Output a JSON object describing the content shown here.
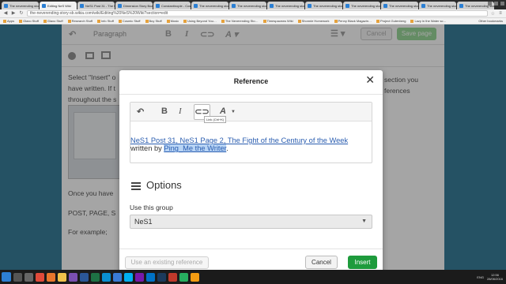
{
  "browser": {
    "tabs": [
      {
        "label": "The neverending story sto…",
        "active": false
      },
      {
        "label": "Editing NeS Wiki",
        "active": true
      },
      {
        "label": "NeS1 Post 31 - The Neve…",
        "active": false
      },
      {
        "label": "Dimension Story Board",
        "active": false
      },
      {
        "label": "Constantinople - Cosmo…",
        "active": false
      },
      {
        "label": "The neverending story sto…",
        "active": false
      },
      {
        "label": "The neverending story sto…",
        "active": false
      },
      {
        "label": "The neverending story sto…",
        "active": false
      },
      {
        "label": "The neverending story sto…",
        "active": false
      },
      {
        "label": "The neverending story sto…",
        "active": false
      },
      {
        "label": "The neverending story sto…",
        "active": false
      },
      {
        "label": "The neverending story sto…",
        "active": false
      },
      {
        "label": "The neverending story sto…",
        "active": false
      }
    ],
    "user": "Asha Lawrence",
    "url": "the-neverending-story-sb.wikia.com/wiki/Editing%20NeS%20Wiki?section=edit",
    "bookmarks": [
      "Apps",
      "Glaxo Stuff",
      "Glaxo Stuff",
      "Research Stuff",
      "Info Stuff",
      "Cosmic Stuff",
      "Buy Stuff",
      "Music",
      "Using Beyond You…",
      "The Neverending Sto…",
      "Timespacews Wiki",
      "Shonnie Homework",
      "Penny Black Magazin…",
      "Project Gutenberg",
      "Lazy in the Water sc…"
    ],
    "other_bookmarks": "Other bookmarks"
  },
  "editor": {
    "toolbar": {
      "paragraph_label": "Paragraph",
      "cancel_label": "Cancel",
      "save_label": "Save page"
    },
    "content": {
      "line1_left": "Select \"Insert\" o",
      "line1_right": "section you",
      "line2_left": "have written. If t",
      "line2_right": "ferences",
      "line3_left": "throughout the s",
      "line4": "Once you have",
      "line5": "POST, PAGE, S",
      "line6": "For example;"
    }
  },
  "dialog": {
    "title": "Reference",
    "tooltip": "Link (Ctrl+K)",
    "reference_text_line1": "NeS1 Post 31, NeS1 Page 2, The Fight of the Century of the Week",
    "reference_text_prefix": "written by ",
    "reference_author": "Ping_Me the Writer",
    "reference_text_suffix": ".",
    "options_title": "Options",
    "group_label": "Use this group",
    "group_value": "NeS1",
    "existing_reference_label": "Use an existing reference",
    "cancel_label": "Cancel",
    "insert_label": "Insert"
  },
  "taskbar": {
    "language": "ENG",
    "time": "12:56",
    "date": "28/06/2016",
    "apps": [
      {
        "name": "start",
        "color": "#2d7fd3"
      },
      {
        "name": "search",
        "color": "#555555"
      },
      {
        "name": "task-view",
        "color": "#666666"
      },
      {
        "name": "chrome",
        "color": "#e04a3a"
      },
      {
        "name": "firefox",
        "color": "#e8762c"
      },
      {
        "name": "explorer",
        "color": "#f0c24b"
      },
      {
        "name": "media",
        "color": "#7a4fb0"
      },
      {
        "name": "word",
        "color": "#2b5797"
      },
      {
        "name": "excel",
        "color": "#1e7145"
      },
      {
        "name": "photos",
        "color": "#0a8fd1"
      },
      {
        "name": "store",
        "color": "#3a7bd5"
      },
      {
        "name": "skype",
        "color": "#00aff0"
      },
      {
        "name": "onenote",
        "color": "#7719aa"
      },
      {
        "name": "mail",
        "color": "#0072c6"
      },
      {
        "name": "photoshop",
        "color": "#1b3a5c"
      },
      {
        "name": "app",
        "color": "#c0392b"
      },
      {
        "name": "app",
        "color": "#27ae60"
      },
      {
        "name": "app",
        "color": "#f39c12"
      }
    ]
  }
}
